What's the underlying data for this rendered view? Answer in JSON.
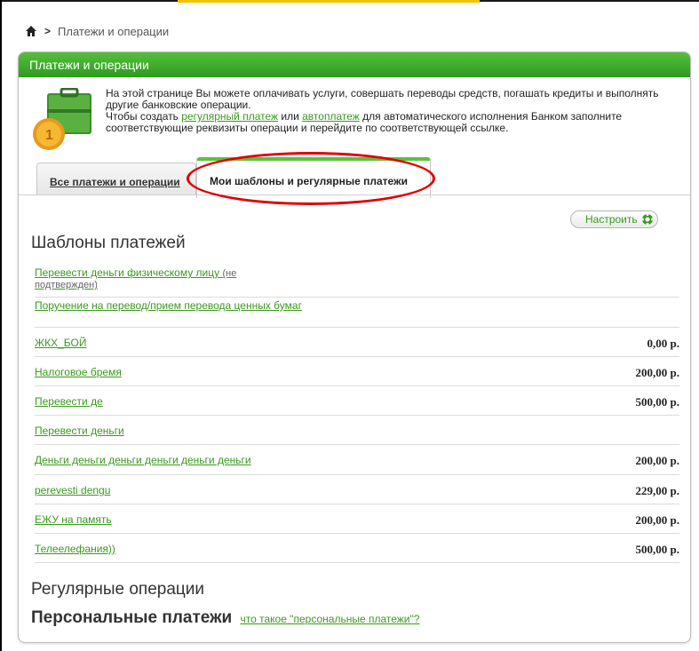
{
  "breadcrumb": {
    "home_icon": "home-icon",
    "current": "Платежи и операции"
  },
  "panel": {
    "title": "Платежи и операции",
    "intro": {
      "line1": "На этой странице Вы можете оплачивать услуги, совершать переводы средств, погашать кредиты и выполнять другие банковские операции.",
      "line2_prefix": "Чтобы создать ",
      "link_regular": "регулярный платеж",
      "line2_mid": " или ",
      "link_auto": "автоплатеж",
      "line2_suffix": " для автоматического исполнения Банком заполните соответствующие реквизиты операции и перейдите по соответствующей ссылке."
    }
  },
  "tabs": [
    {
      "label": "Все платежи и операции"
    },
    {
      "label": "Мои шаблоны и регулярные платежи"
    }
  ],
  "configure_label": "Настроить",
  "templates_heading": "Шаблоны платежей",
  "templates": [
    {
      "name": "Перевести деньги физическому лицу",
      "note": "(не подтвержден)",
      "amount": ""
    },
    {
      "name": "Поручение на перевод/прием перевода ценных бумаг",
      "note": "",
      "amount": ""
    },
    {
      "name": "ЖКХ_БОЙ",
      "note": "",
      "amount": "0,00 р."
    },
    {
      "name": "Налоговое бремя",
      "note": "",
      "amount": "200,00 р."
    },
    {
      "name": "Перевести де",
      "note": "",
      "amount": "500,00 р."
    },
    {
      "name": "Перевести деньги",
      "note": "",
      "amount": ""
    },
    {
      "name": "Деньги деньги деньги деньги деньги деньги",
      "note": "",
      "amount": "200,00 р."
    },
    {
      "name": "perevesti dengu",
      "note": "",
      "amount": "229,00 р."
    },
    {
      "name": "ЕЖУ на память",
      "note": "",
      "amount": "200,00 р."
    },
    {
      "name": "Телеелефания))",
      "note": "",
      "amount": "500,00 р."
    }
  ],
  "regular_heading": "Регулярные операции",
  "personal_heading": "Персональные платежи",
  "personal_link": "что такое \"персональные платежи\"?",
  "colors": {
    "accent_green": "#3a9a1e",
    "header_green": "#2e9b1f",
    "annotation_red": "#e00000"
  }
}
